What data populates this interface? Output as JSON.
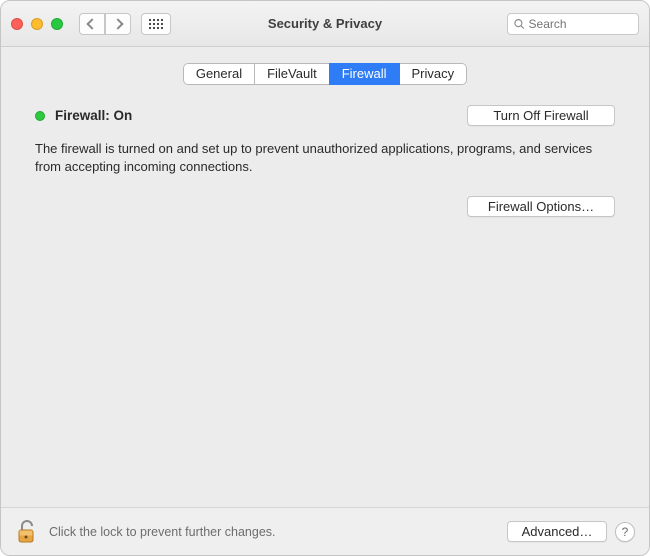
{
  "titlebar": {
    "title": "Security & Privacy",
    "search_placeholder": "Search"
  },
  "tabs": [
    {
      "label": "General",
      "active": false
    },
    {
      "label": "FileVault",
      "active": false
    },
    {
      "label": "Firewall",
      "active": true
    },
    {
      "label": "Privacy",
      "active": false
    }
  ],
  "firewall": {
    "status_label": "Firewall: On",
    "turn_off_button": "Turn Off Firewall",
    "description": "The firewall is turned on and set up to prevent unauthorized applications, programs, and services from accepting incoming connections.",
    "options_button": "Firewall Options…"
  },
  "footer": {
    "lock_text": "Click the lock to prevent further changes.",
    "advanced_button": "Advanced…",
    "help_label": "?"
  },
  "colors": {
    "accent": "#2e7cf6",
    "status_on": "#2fc940"
  }
}
